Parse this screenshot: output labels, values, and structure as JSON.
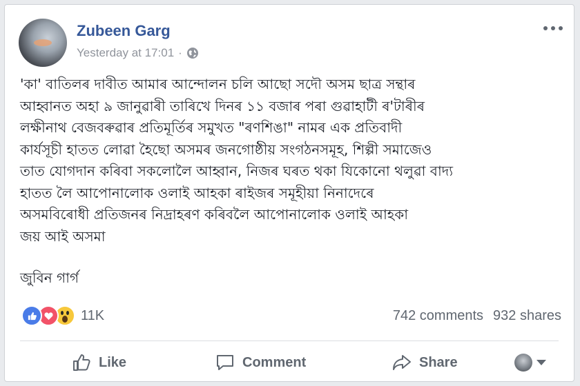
{
  "post": {
    "author": "Zubeen Garg",
    "timestamp": "Yesterday at 17:01",
    "separator": "·",
    "privacy_icon": "globe-icon",
    "more_icon": "more-dots-icon",
    "lines": [
      "'কা' বাতিলৰ দাবীত আমাৰ আন্দোলন চলি আছো সদৌ অসম ছাত্ৰ সন্থাৰ",
      "আহ্বানত অহা ৯ জানুৱাৰী তাৰিখে দিনৰ ১১ বজাৰ পৰা গুৱাহাটী ৰ'টাৰীৰ",
      "লক্ষীনাথ বেজবৰুৱাৰ প্ৰতিমূৰ্তিৰ সমুখত \"ৰণশিঙা\" নামৰ এক প্ৰতিবাদী",
      "কাৰ্যসূচী হাতত লোৱা হৈছো অসমৰ জনগোষ্ঠীয় সংগঠনসমূহ, শিল্পী সমাজেও",
      "তাত যোগদান কৰিবা সকলোলৈ আহ্বান, নিজৰ ঘৰত থকা যিকোনো থলুৱা বাদ্য",
      "হাতত লৈ আপোনালোক ওলাই আহকা ৰাইজৰ সমূহীয়া নিনাদেৰে",
      "অসমবিৰোধী প্ৰতিজনৰ নিদ্ৰাহৰণ কৰিবলৈ আপোনালোক ওলাই আহকা",
      "জয় আই অসমা"
    ],
    "signature": "জুবিন গাৰ্গ"
  },
  "reactions": {
    "types": [
      "like-reaction-icon",
      "love-reaction-icon",
      "wow-reaction-icon"
    ],
    "count": "11K"
  },
  "stats": {
    "comments": "742 comments",
    "shares": "932 shares"
  },
  "actions": {
    "like_label": "Like",
    "comment_label": "Comment",
    "share_label": "Share"
  },
  "colors": {
    "author": "#365899",
    "meta": "#90949c",
    "action": "#606770",
    "like_reaction": "#4a7ce8",
    "love_reaction": "#f25268",
    "wow_reaction": "#f7c83b"
  }
}
